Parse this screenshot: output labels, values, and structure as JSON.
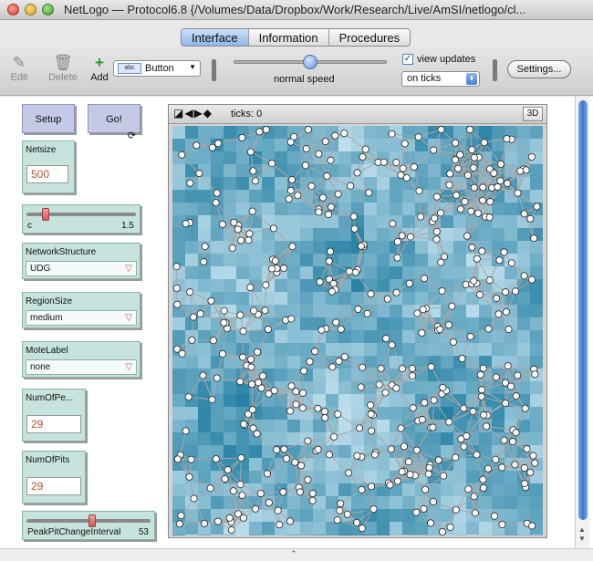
{
  "window": {
    "title": "NetLogo — Protocol6.8 {/Volumes/Data/Dropbox/Work/Research/Live/AmSI/netlogo/cl..."
  },
  "tabs": [
    {
      "label": "Interface",
      "active": true
    },
    {
      "label": "Information",
      "active": false
    },
    {
      "label": "Procedures",
      "active": false
    }
  ],
  "toolbar": {
    "edit_label": "Edit",
    "delete_label": "Delete",
    "add_label": "Add",
    "widget_type": "Button",
    "speed_label": "normal speed",
    "view_updates_label": "view updates",
    "view_updates_checked": true,
    "update_mode": "on ticks",
    "settings_label": "Settings..."
  },
  "widgets": {
    "setup_label": "Setup",
    "go_label": "Go!",
    "netsize": {
      "label": "Netsize",
      "value": "500"
    },
    "c_slider": {
      "label": "c",
      "value": "1.5",
      "fraction": 0.15
    },
    "network_structure": {
      "label": "NetworkStructure",
      "value": "UDG"
    },
    "region_size": {
      "label": "RegionSize",
      "value": "medium"
    },
    "mote_label": {
      "label": "MoteLabel",
      "value": "none"
    },
    "num_of_pe": {
      "label": "NumOfPe...",
      "value": "29"
    },
    "num_of_pits": {
      "label": "NumOfPits",
      "value": "29"
    },
    "peak_pit": {
      "label": "PeakPitChangeInterval",
      "value": "53",
      "fraction": 0.53
    }
  },
  "view": {
    "ticks_label": "ticks: 0",
    "btn_3d": "3D",
    "colors": {
      "patch_light": "#d4ecf7",
      "patch_dark": "#0a6f96",
      "mote": "#ffffff",
      "link": "#a9a9a9"
    }
  }
}
